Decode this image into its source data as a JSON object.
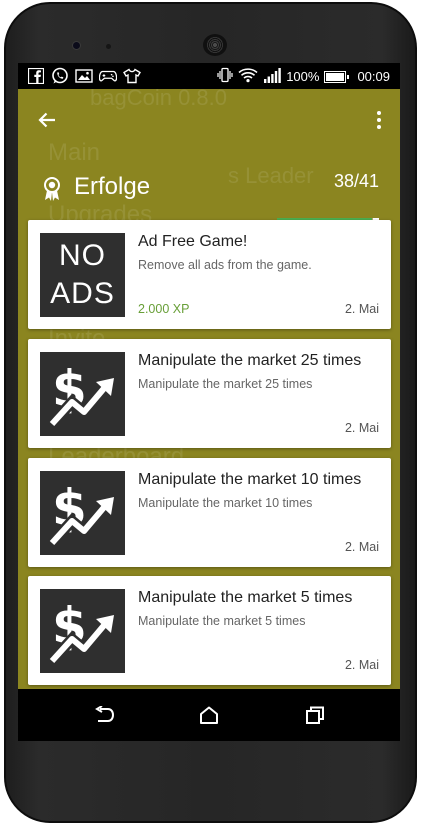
{
  "statusbar": {
    "left_icons": [
      "facebook-icon",
      "whatsapp-icon",
      "image-icon",
      "gamepad-icon",
      "shirt-icon"
    ],
    "battery_percent": "100%",
    "time": "00:09"
  },
  "background_ghost": {
    "app_title": "bagCoin 0.8.0",
    "menu_main": "Main",
    "menu_upgrades": "Upgrades",
    "menu_invite": "Invite",
    "menu_leaderboard": "Leaderboard",
    "menu_partial": "s Leader"
  },
  "appbar": {
    "title": "Erfolge",
    "progress_text": "38/41",
    "progress_value": 0.927
  },
  "achievements": [
    {
      "image": "no-ads",
      "image_lines": [
        "NO",
        "ADS"
      ],
      "title": "Ad Free Game!",
      "description": "Remove all ads from the game.",
      "xp": "2.000 XP",
      "date": "2. Mai"
    },
    {
      "image": "dollar-chart",
      "title": "Manipulate the market 25 times",
      "description": "Manipulate the market 25 times",
      "xp": "",
      "date": "2. Mai"
    },
    {
      "image": "dollar-chart",
      "title": "Manipulate the market 10 times",
      "description": "Manipulate the market 10 times",
      "xp": "",
      "date": "2. Mai"
    },
    {
      "image": "dollar-chart",
      "title": "Manipulate the market 5 times",
      "description": "Manipulate the market 5 times",
      "xp": "",
      "date": "2. Mai"
    }
  ],
  "navbar": {
    "buttons": [
      "back-icon",
      "home-icon",
      "recents-icon"
    ]
  },
  "colors": {
    "screen_bg": "#8b8520",
    "xp_green": "#689f38",
    "progress_green": "#4caf50",
    "image_bg": "#2f2f2f"
  }
}
